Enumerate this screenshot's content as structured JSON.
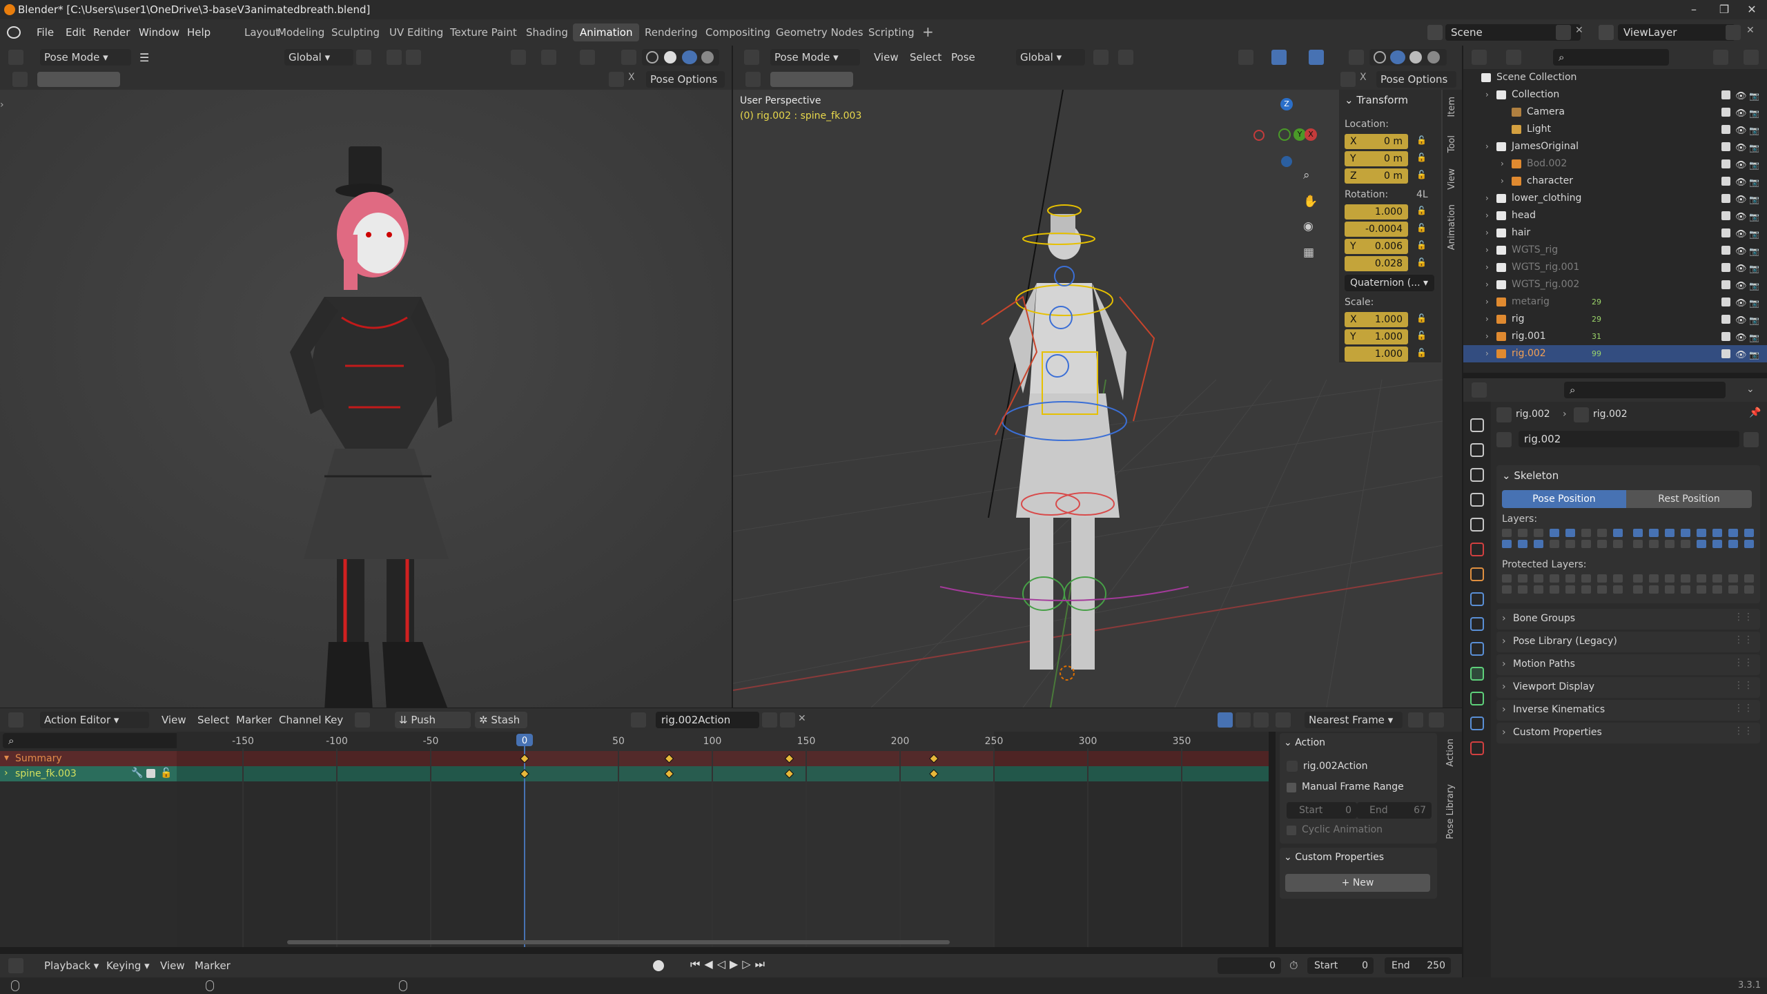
{
  "title": "Blender* [C:\\Users\\user1\\OneDrive\\3-baseV3animatedbreath.blend]",
  "menus": [
    "File",
    "Edit",
    "Render",
    "Window",
    "Help"
  ],
  "workspaces": [
    "Layout",
    "Modeling",
    "Sculpting",
    "UV Editing",
    "Texture Paint",
    "Shading",
    "Animation",
    "Rendering",
    "Compositing",
    "Geometry Nodes",
    "Scripting"
  ],
  "active_workspace": "Animation",
  "scene": "Scene",
  "view_layer": "ViewLayer",
  "left_viewport": {
    "mode": "Pose Mode",
    "orientation": "Global",
    "pose_options": "Pose Options"
  },
  "right_viewport": {
    "mode": "Pose Mode",
    "menus": [
      "View",
      "Select",
      "Pose"
    ],
    "orientation": "Global",
    "pose_options": "Pose Options",
    "perspective": "User Perspective",
    "object_info": "(0) rig.002 : spine_fk.003",
    "gizmo": {
      "z": "Z",
      "y": "Y",
      "x": "X"
    },
    "side_tabs": [
      "Item",
      "Tool",
      "View",
      "Animation"
    ]
  },
  "transform": {
    "title": "Transform",
    "location_label": "Location:",
    "location": [
      {
        "axis": "X",
        "value": "0 m"
      },
      {
        "axis": "Y",
        "value": "0 m"
      },
      {
        "axis": "Z",
        "value": "0 m"
      }
    ],
    "rotation_label": "Rotation:",
    "rotation_mode_short": "4L",
    "rotation": [
      {
        "axis": "",
        "value": "1.000"
      },
      {
        "axis": "",
        "value": "-0.0004"
      },
      {
        "axis": "Y",
        "value": "0.006"
      },
      {
        "axis": "",
        "value": "0.028"
      }
    ],
    "rotation_mode": "Quaternion (...",
    "scale_label": "Scale:",
    "scale": [
      {
        "axis": "X",
        "value": "1.000"
      },
      {
        "axis": "Y",
        "value": "1.000"
      },
      {
        "axis": "",
        "value": "1.000"
      }
    ]
  },
  "outliner": {
    "search_placeholder": "",
    "items": [
      {
        "label": "Scene Collection",
        "indent": 0,
        "icon": "collection",
        "color": "#cfcfcf"
      },
      {
        "label": "Collection",
        "indent": 1,
        "icon": "collection",
        "color": "#d8d8d8"
      },
      {
        "label": "Camera",
        "indent": 2,
        "icon": "camera",
        "color": "#d8d8d8"
      },
      {
        "label": "Light",
        "indent": 2,
        "icon": "light",
        "color": "#d8d8d8"
      },
      {
        "label": "JamesOriginal",
        "indent": 1,
        "icon": "collection",
        "color": "#d8d8d8"
      },
      {
        "label": "Bod.002",
        "indent": 2,
        "icon": "mesh",
        "color": "#7d7d7d"
      },
      {
        "label": "character",
        "indent": 2,
        "icon": "mesh",
        "color": "#d8d8d8"
      },
      {
        "label": "lower_clothing",
        "indent": 1,
        "icon": "collection",
        "color": "#d8d8d8"
      },
      {
        "label": "head",
        "indent": 1,
        "icon": "collection",
        "color": "#d8d8d8"
      },
      {
        "label": "hair",
        "indent": 1,
        "icon": "collection",
        "color": "#d8d8d8"
      },
      {
        "label": "WGTS_rig",
        "indent": 1,
        "icon": "collection",
        "color": "#7d7d7d"
      },
      {
        "label": "WGTS_rig.001",
        "indent": 1,
        "icon": "collection",
        "color": "#7d7d7d"
      },
      {
        "label": "WGTS_rig.002",
        "indent": 1,
        "icon": "collection",
        "color": "#7d7d7d"
      },
      {
        "label": "metarig",
        "indent": 1,
        "icon": "armature",
        "color": "#7d7d7d",
        "badge": "29"
      },
      {
        "label": "rig",
        "indent": 1,
        "icon": "armature",
        "color": "#d8d8d8",
        "badge": "29"
      },
      {
        "label": "rig.001",
        "indent": 1,
        "icon": "armature",
        "color": "#d8d8d8",
        "badge": "31"
      },
      {
        "label": "rig.002",
        "indent": 1,
        "icon": "armature",
        "color": "#f2a055",
        "badge": "99",
        "selected": true
      }
    ]
  },
  "properties": {
    "breadcrumb": [
      "rig.002",
      "rig.002"
    ],
    "datablock": "rig.002",
    "skeleton_title": "Skeleton",
    "pose_position": "Pose Position",
    "rest_position": "Rest Position",
    "layers_label": "Layers:",
    "protected_layers_label": "Protected Layers:",
    "panels": [
      "Bone Groups",
      "Pose Library (Legacy)",
      "Motion Paths",
      "Viewport Display",
      "Inverse Kinematics",
      "Custom Properties"
    ]
  },
  "action_editor": {
    "mode": "Action Editor",
    "menus": [
      "View",
      "Select",
      "Marker",
      "Channel",
      "Key"
    ],
    "push_down": "Push Down",
    "stash": "Stash",
    "action_name": "rig.002Action",
    "snapping": "Nearest Frame",
    "ruler": [
      "-150",
      "-100",
      "-50",
      "0",
      "50",
      "100",
      "150",
      "200",
      "250",
      "300",
      "350"
    ],
    "current_frame": "0",
    "channels": [
      "Summary",
      "spine_fk.003"
    ],
    "keyframes": [
      0,
      77,
      141,
      218
    ],
    "side_tabs": [
      "Action",
      "Pose Library"
    ],
    "action_panel": {
      "title": "Action",
      "name": "rig.002Action",
      "manual_range": "Manual Frame Range",
      "start_label": "Start",
      "start": "0",
      "end_label": "End",
      "end": "67",
      "cyclic": "Cyclic Animation"
    },
    "custom_props": {
      "title": "Custom Properties",
      "new": "New"
    }
  },
  "timeline": {
    "menus": [
      "Playback",
      "Keying",
      "View",
      "Marker"
    ],
    "frame": "0",
    "start_label": "Start",
    "start": "0",
    "end_label": "End",
    "end": "250"
  },
  "status": {
    "version": "3.3.1"
  }
}
